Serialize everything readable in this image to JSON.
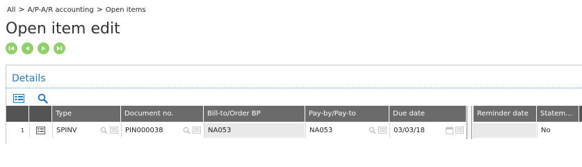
{
  "breadcrumb": {
    "items": [
      "All",
      "A/P-A/R accounting",
      "Open items"
    ],
    "separator": ">"
  },
  "page": {
    "title": "Open item edit"
  },
  "section": {
    "title": "Details"
  },
  "grid": {
    "headers": [
      "Type",
      "Document no.",
      "Bill-to/Order BP",
      "Pay-by/Pay-to",
      "Due date",
      "Reminder date",
      "Statem..."
    ],
    "rows": [
      {
        "num": "1",
        "type": "SPINV",
        "document_no": "PIN000038",
        "bill_to": "NA053",
        "pay_by": "NA053",
        "due_date": "03/03/18",
        "reminder_date": "",
        "statement": "No"
      }
    ]
  },
  "colors": {
    "accent_blue": "#2a79b7",
    "nav_green": "#8fd06b",
    "header_grey": "#6b6b6b"
  },
  "icons": [
    "first-record-icon",
    "previous-record-icon",
    "next-record-icon",
    "last-record-icon",
    "detail-view-icon",
    "search-icon",
    "calendar-icon"
  ]
}
